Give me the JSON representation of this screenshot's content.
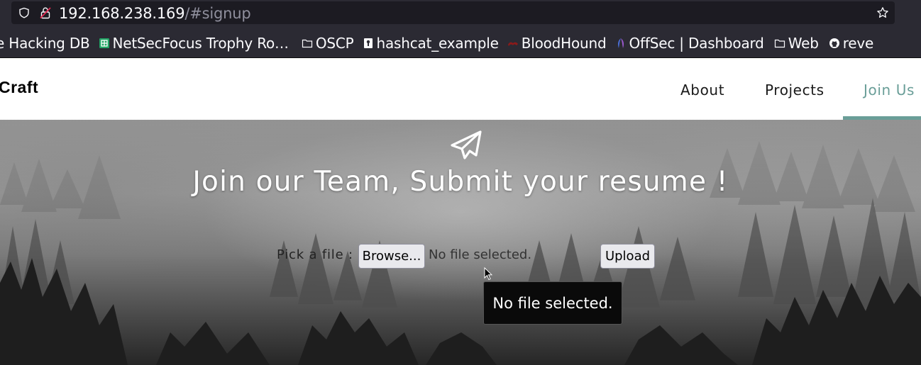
{
  "browser": {
    "url_host": "192.168.238.169",
    "url_path": "/#signup",
    "bookmarks": [
      {
        "label": "e Hacking DB",
        "icon": "none"
      },
      {
        "label": "NetSecFocus Trophy Ro…",
        "icon": "spreadsheet-icon"
      },
      {
        "label": "OSCP",
        "icon": "folder-icon"
      },
      {
        "label": "hashcat_example",
        "icon": "keyhole-icon"
      },
      {
        "label": "BloodHound",
        "icon": "bloodhound-icon"
      },
      {
        "label": "OffSec | Dashboard",
        "icon": "offsec-icon"
      },
      {
        "label": "Web",
        "icon": "folder-icon"
      },
      {
        "label": "reve",
        "icon": "github-icon"
      }
    ]
  },
  "nav": {
    "brand": "Craft",
    "links": [
      "About",
      "Projects",
      "Join Us"
    ],
    "active": "Join Us",
    "accent_color": "#6a9e98"
  },
  "hero": {
    "title": "Join our Team, Submit your resume !",
    "file_label": "Pick a file :",
    "browse_label": "Browse...",
    "no_file_text": "No file selected.",
    "upload_label": "Upload",
    "tooltip": "No file selected."
  }
}
